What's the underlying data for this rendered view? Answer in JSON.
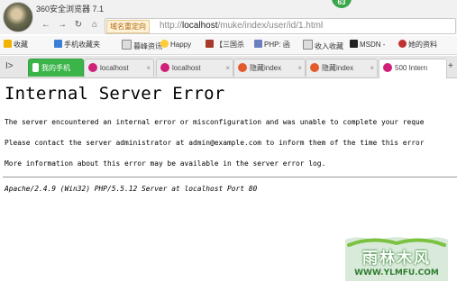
{
  "titlebar": {
    "title": "360安全浏览器 7.1",
    "badge": "63"
  },
  "nav": {
    "redirect_label": "域名重定向",
    "url_prefix": "http://",
    "url_host": "localhost",
    "url_path": "/muke/index/user/id/1.html"
  },
  "bookmarks": [
    {
      "label": "收藏",
      "icon_color": "#f0b400"
    },
    {
      "label": "手机收藏夹",
      "icon_color": "#3a7fd5"
    },
    {
      "label": "暮峰资讯",
      "icon_color": "#888888"
    },
    {
      "label": "Happy",
      "icon_color": "#ffcc33"
    },
    {
      "label": "【三国杀",
      "icon_color": "#a83a2a"
    },
    {
      "label": "PHP: 函",
      "icon_color": "#6a7fbf"
    },
    {
      "label": "收入收藏",
      "icon_color": "#888888"
    },
    {
      "label": "MSDN -",
      "icon_color": "#222222"
    },
    {
      "label": "她的资料",
      "icon_color": "#c03030"
    }
  ],
  "tabs": [
    {
      "label": "我的手机",
      "kind": "green"
    },
    {
      "label": "localhost",
      "kind": "normal"
    },
    {
      "label": "localhost",
      "kind": "normal"
    },
    {
      "label": "隐藏index",
      "kind": "normal"
    },
    {
      "label": "隐藏index",
      "kind": "normal"
    },
    {
      "label": "500 Intern",
      "kind": "active"
    }
  ],
  "page": {
    "heading": "Internal Server Error",
    "line1": "The server encountered an internal error or misconfiguration and was unable to complete your reque",
    "line2": "Please contact the server administrator at admin@example.com to inform them of the time this error",
    "line3": "More information about this error may be available in the server error log.",
    "address": "Apache/2.4.9 (Win32) PHP/5.5.12 Server at localhost Port 80"
  },
  "watermark": {
    "brand": "雨林木风",
    "url": "WWW.YLMFU.COM"
  }
}
